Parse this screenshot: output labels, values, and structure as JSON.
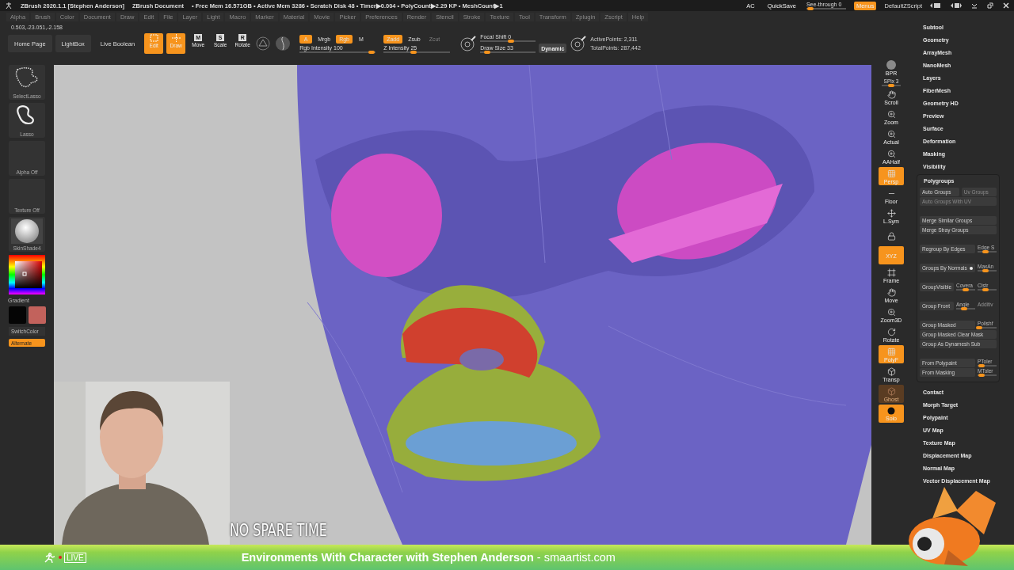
{
  "title_bar": {
    "app_title": "ZBrush 2020.1.1 [Stephen Anderson]",
    "document": "ZBrush Document",
    "stats": "• Free Mem 16.571GB • Active Mem 3286 • Scratch Disk 48 • Timer▶0.004 • PolyCount▶2.29 KP • MeshCount▶1",
    "buttons": [
      "AC",
      "QuickSave"
    ],
    "see_through": {
      "label": "See-through",
      "value": "0",
      "level": 0.02
    },
    "menus": {
      "label": "Menus",
      "on": true
    },
    "script": "DefaultZScript"
  },
  "menu_bar": [
    "Alpha",
    "Brush",
    "Color",
    "Document",
    "Draw",
    "Edit",
    "File",
    "Layer",
    "Light",
    "Macro",
    "Marker",
    "Material",
    "Movie",
    "Picker",
    "Preferences",
    "Render",
    "Stencil",
    "Stroke",
    "Texture",
    "Tool",
    "Transform",
    "Zplugin",
    "Zscript",
    "Help"
  ],
  "coordinates": "0.503,-23.051,-2.158",
  "top_shelf": {
    "nav_buttons": [
      "Home Page",
      "LightBox",
      "Live Boolean"
    ],
    "modes": [
      {
        "kind": "edit",
        "label": "Edit",
        "on": true
      },
      {
        "kind": "draw",
        "label": "Draw",
        "on": true
      },
      {
        "kind": "letter",
        "letter": "M",
        "label": "Move",
        "on": false
      },
      {
        "kind": "letter",
        "letter": "S",
        "label": "Scale",
        "on": false
      },
      {
        "kind": "letter",
        "letter": "R",
        "label": "Rotate",
        "on": false
      }
    ],
    "color_toggles": [
      {
        "label": "A",
        "on": true
      },
      {
        "label": "Mrgb",
        "on": false
      },
      {
        "label": "Rgb",
        "on": true
      },
      {
        "label": "M",
        "on": false
      }
    ],
    "depth_toggles": [
      {
        "label": "Zadd",
        "on": true,
        "disabled": false
      },
      {
        "label": "Zsub",
        "on": false,
        "disabled": false
      },
      {
        "label": "Zcut",
        "on": false,
        "disabled": true
      }
    ],
    "rgb_intensity": {
      "label": "Rgb Intensity",
      "value": "100",
      "level": 0.95
    },
    "z_intensity": {
      "label": "Z Intensity",
      "value": "25",
      "level": 0.45
    },
    "focal_shift": {
      "label": "Focal Shift",
      "value": "0",
      "level": 0.55
    },
    "draw_size": {
      "label": "Draw Size",
      "value": "33",
      "level": 0.12
    },
    "dynamic": "Dynamic",
    "active_points": "ActivePoints: 2,311",
    "total_points": "TotalPoints: 287,442"
  },
  "left_shelf": {
    "tools": [
      {
        "kind": "select_lasso",
        "label": "SelectLasso"
      },
      {
        "kind": "lasso",
        "label": "Lasso"
      },
      {
        "kind": "empty",
        "label": "Alpha Off"
      },
      {
        "kind": "empty",
        "label": "Texture Off"
      },
      {
        "kind": "material",
        "label": "SkinShade4"
      }
    ],
    "gradient": "Gradient",
    "swatches": [
      {
        "color": "#050505"
      },
      {
        "color": "#c2625c"
      }
    ],
    "switch_color": "SwitchColor",
    "alternate": {
      "label": "Alternate",
      "on": true
    }
  },
  "canvas": {
    "kind": "picture",
    "overlay_caption": "NO SPARE TIME"
  },
  "right_shelf": [
    {
      "kind": "bpr",
      "label": "BPR",
      "on": false
    },
    {
      "kind": "slider",
      "label": "SPix 3",
      "level": 0.5
    },
    {
      "kind": "scroll",
      "label": "Scroll",
      "on": false
    },
    {
      "kind": "zoom",
      "label": "Zoom",
      "on": false
    },
    {
      "kind": "zoom",
      "label": "Actual",
      "on": false
    },
    {
      "kind": "zoom",
      "label": "AAHalf",
      "on": false
    },
    {
      "kind": "grid",
      "label": "Persp",
      "on": true
    },
    {
      "kind": "floor",
      "label": "Floor",
      "on": false
    },
    {
      "kind": "sym",
      "label": "L.Sym",
      "on": false
    },
    {
      "kind": "lock",
      "on": false
    },
    {
      "kind": "text",
      "label": "XYZ",
      "on": true
    },
    {
      "kind": "frame",
      "label": "Frame",
      "on": false
    },
    {
      "kind": "scroll",
      "label": "Move",
      "on": false
    },
    {
      "kind": "zoom",
      "label": "Zoom3D",
      "on": false
    },
    {
      "kind": "rotate",
      "label": "Rotate",
      "on": false
    },
    {
      "kind": "grid",
      "label": "PolyF",
      "on": true
    },
    {
      "kind": "cube",
      "label": "Transp",
      "on": false
    },
    {
      "kind": "ghost",
      "label": "Ghost",
      "on": false
    },
    {
      "kind": "solo",
      "label": "Solo",
      "on": true
    }
  ],
  "tray": {
    "sections_above": [
      "Subtool",
      "Geometry",
      "ArrayMesh",
      "NanoMesh",
      "Layers",
      "FiberMesh",
      "Geometry HD",
      "Preview",
      "Surface",
      "Deformation",
      "Masking",
      "Visibility"
    ],
    "polygroups": {
      "title": "Polygroups",
      "expanded": true,
      "groups": [
        [
          [
            {
              "kind": "button",
              "label": "Auto Groups",
              "disabled": false
            },
            {
              "kind": "button",
              "label": "Uv Groups",
              "disabled": true
            }
          ],
          [
            {
              "kind": "button",
              "label": "Auto Groups With UV",
              "disabled": true
            }
          ]
        ],
        [
          [
            {
              "kind": "button",
              "label": "Merge Similar Groups",
              "disabled": false
            }
          ],
          [
            {
              "kind": "button",
              "label": "Merge Stray Groups",
              "disabled": false
            }
          ]
        ],
        [
          [
            {
              "kind": "button",
              "label": "Regroup By Edges",
              "disabled": false
            },
            {
              "kind": "slider",
              "label": "Edge S",
              "level": 0.4
            }
          ]
        ],
        [
          [
            {
              "kind": "toggle",
              "label": "Groups By Normals",
              "on": true
            },
            {
              "kind": "slider",
              "label": "MaxAn",
              "level": 0.4
            }
          ]
        ],
        [
          [
            {
              "kind": "button",
              "label": "GroupVisible",
              "disabled": false
            },
            {
              "kind": "slider",
              "label": "Covera",
              "level": 0.5
            },
            {
              "kind": "slider",
              "label": "Clstr",
              "level": 0.4
            }
          ]
        ],
        [
          [
            {
              "kind": "button",
              "label": "Group Front",
              "disabled": false
            },
            {
              "kind": "slider",
              "label": "Angle",
              "level": 0.4
            },
            {
              "kind": "label",
              "label": "Additiv"
            }
          ]
        ],
        [
          [
            {
              "kind": "button",
              "label": "Group Masked",
              "disabled": false
            },
            {
              "kind": "slider",
              "label": "Polishf",
              "level": 0.1
            }
          ],
          [
            {
              "kind": "button",
              "label": "Group Masked Clear Mask",
              "disabled": false
            }
          ],
          [
            {
              "kind": "button",
              "label": "Group As Dynamesh Sub",
              "disabled": false
            }
          ]
        ],
        [
          [
            {
              "kind": "button",
              "label": "From Polypaint",
              "disabled": false
            },
            {
              "kind": "slider",
              "label": "PToler",
              "level": 0.2
            }
          ],
          [
            {
              "kind": "button",
              "label": "From Masking",
              "disabled": false
            },
            {
              "kind": "slider",
              "label": "MToler",
              "level": 0.2
            }
          ]
        ]
      ]
    },
    "sections_below": [
      "Contact",
      "Morph Target",
      "Polypaint",
      "UV Map",
      "Texture Map",
      "Displacement Map",
      "Normal Map",
      "Vector Displacement Map"
    ]
  },
  "banner": {
    "badge": "LIVE",
    "text": "**Environments With Character with Stephen Anderson** - smaartist.com"
  }
}
